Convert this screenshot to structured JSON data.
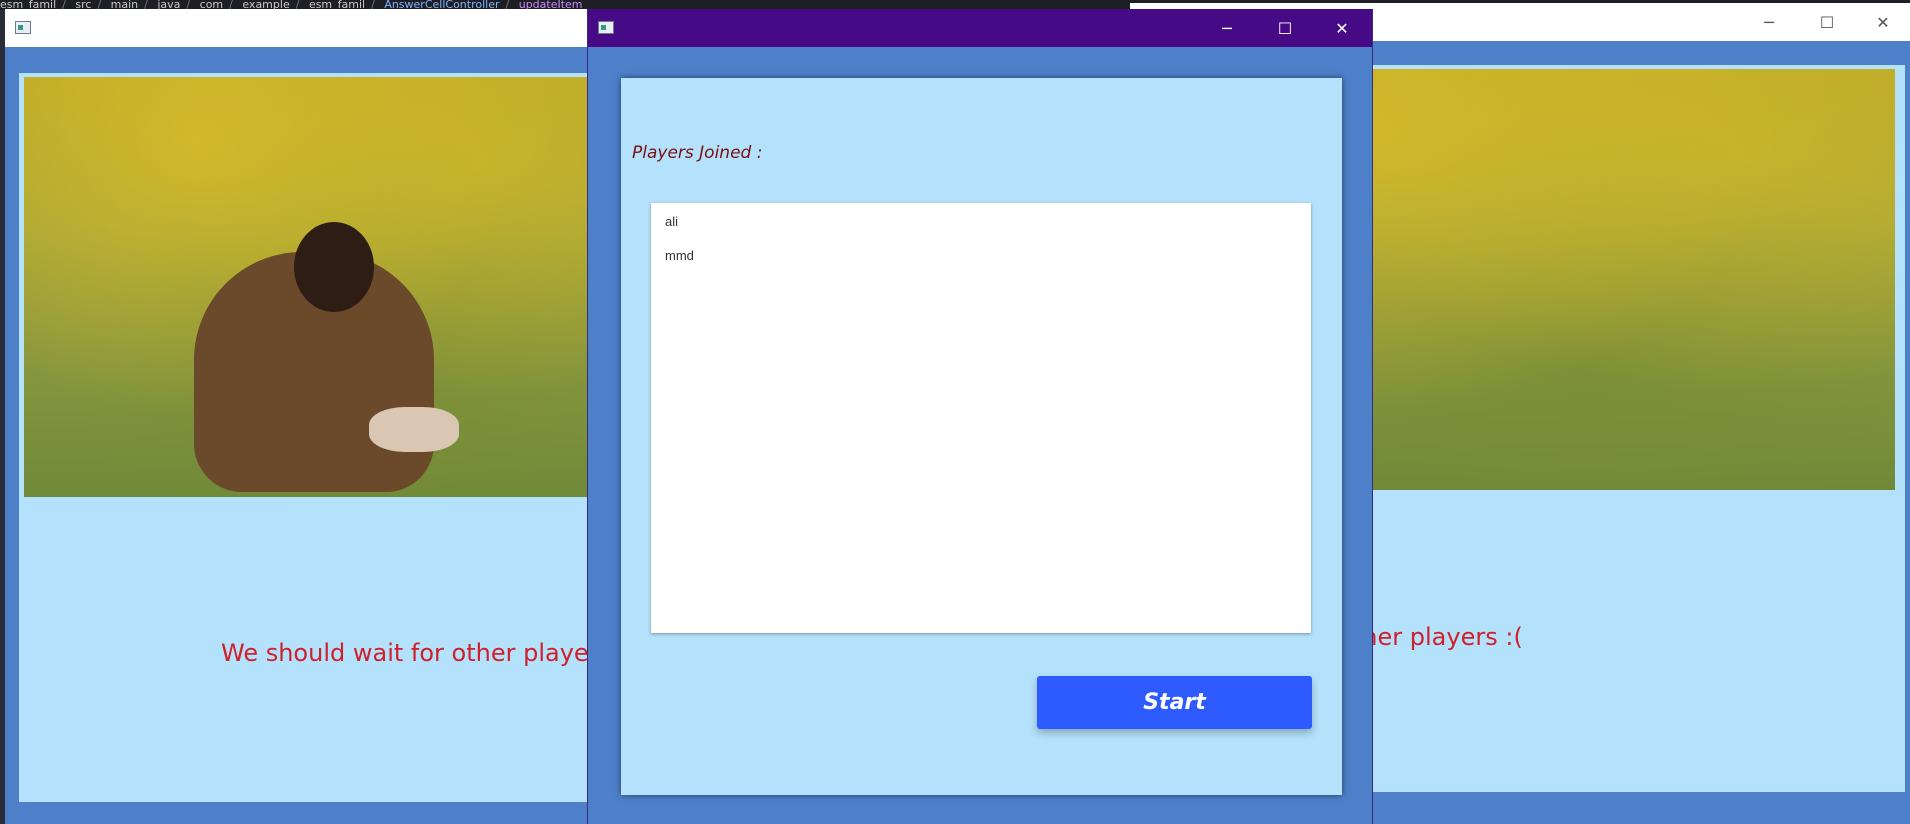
{
  "ide": {
    "breadcrumbs": [
      "esm_famil",
      "src",
      "main",
      "java",
      "com",
      "example",
      "esm_famil"
    ],
    "class_name": "AnswerCellController",
    "method_name": "updateItem"
  },
  "left_window": {
    "status_text": "We should wait for other players"
  },
  "right_window": {
    "status_text": "e should wait for other players :("
  },
  "lobby": {
    "players_label": "Players Joined :",
    "players": [
      "ali",
      "mmd"
    ],
    "start_label": "Start"
  },
  "window_controls": {
    "minimize": "─",
    "maximize": "☐",
    "close": "✕"
  },
  "colors": {
    "title_purple": "#470a87",
    "panel_blue": "#b4e1fb",
    "frame_blue": "#4d80c9",
    "start_blue": "#2e5bff",
    "wait_red": "#d0202a"
  }
}
